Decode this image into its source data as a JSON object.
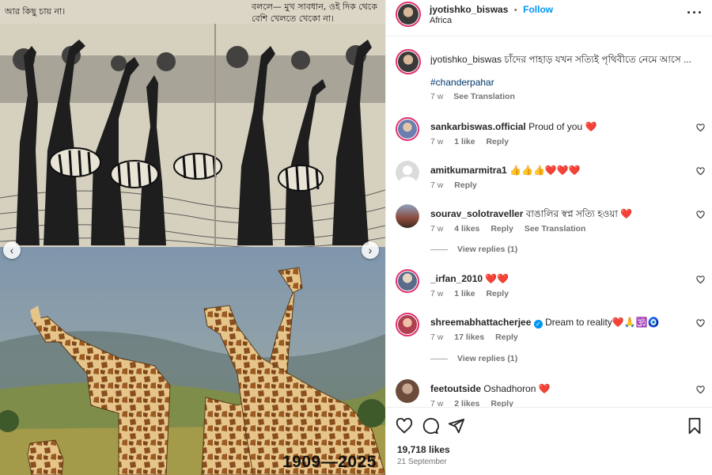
{
  "post": {
    "username": "jyotishko_biswas",
    "separator": "•",
    "follow_label": "Follow",
    "location": "Africa",
    "more_icon": "more-options-icon",
    "image_year_label": "1909—2025",
    "book_text_left": "আর কিছু চায় না।",
    "book_text_right_1": "বললে— মুখ সাবধান, ওই দিক থেকে",
    "book_text_right_2": "বেশি খেলতে খেকো না।"
  },
  "caption": {
    "username": "jyotishko_biswas",
    "text": "চাঁদের পাহাড় যখন সত্যিই পৃথিবীতে নেমে আসে ...",
    "hashtag": "#chanderpahar",
    "time": "7 w",
    "see_translation": "See Translation"
  },
  "comments": [
    {
      "username": "sankarbiswas.official",
      "text": "Proud of you",
      "emoji": "❤️",
      "time": "7 w",
      "likes": "1 like",
      "reply": "Reply",
      "translation": "",
      "avatar_color": "#6a7fb0"
    },
    {
      "username": "amitkumarmitra1",
      "text": "",
      "emoji": "👍👍👍❤️❤️❤️",
      "time": "7 w",
      "likes": "",
      "reply": "Reply",
      "translation": "",
      "avatar_color": "#c7c7c7"
    },
    {
      "username": "sourav_solotraveller",
      "text": "বাঙালির স্বপ্ন সত্যি হওয়া",
      "emoji": "❤️",
      "time": "7 w",
      "likes": "4 likes",
      "reply": "Reply",
      "translation": "See Translation",
      "avatar_color": "#8a4a3a"
    },
    {
      "username": "_irfan_2010",
      "text": "",
      "emoji": "❤️❤️",
      "time": "7 w",
      "likes": "1 like",
      "reply": "Reply",
      "translation": "",
      "avatar_color": "#5a6a8a"
    },
    {
      "username": "shreemabhattacherjee",
      "text": "Dream to reality",
      "emoji": "❤️🙏🕉️🧿",
      "time": "7 w",
      "likes": "17 likes",
      "reply": "Reply",
      "translation": "",
      "avatar_color": "#b04050",
      "verified": true
    },
    {
      "username": "feetoutside",
      "text": "Oshadhoron",
      "emoji": "❤️",
      "time": "7 w",
      "likes": "2 likes",
      "reply": "Reply",
      "translation": "",
      "avatar_color": "#6b4b3b"
    }
  ],
  "view_replies": [
    "View replies (1)",
    "View replies (1)"
  ],
  "footer": {
    "likes": "19,718 likes",
    "date": "21 September"
  },
  "colors": {
    "follow": "#0095f6",
    "heart": "#e0245e",
    "story_ring": "#e1306c"
  }
}
